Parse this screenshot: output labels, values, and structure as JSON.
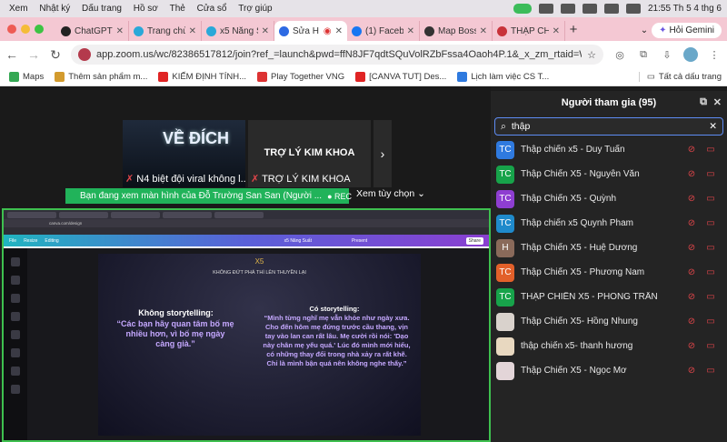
{
  "macbar": {
    "menu": [
      "Xem",
      "Nhật ký",
      "Dấu trang",
      "Hồ sơ",
      "Thẻ",
      "Cửa sổ",
      "Trợ giúp"
    ],
    "clock": "21:55 Th 5 4 thg 6"
  },
  "tabs": [
    {
      "label": "ChatGPT",
      "color": "#222"
    },
    {
      "label": "Trang chủ",
      "color": "#2aa8d8"
    },
    {
      "label": "x5 Năng S",
      "color": "#2aa8d8"
    },
    {
      "label": "Sửa H",
      "color": "#2d6ae3",
      "active": true
    },
    {
      "label": "(1) Facebo",
      "color": "#1877f2"
    },
    {
      "label": "Map Bosse",
      "color": "#333"
    },
    {
      "label": "THẬP CH",
      "color": "#c8333a"
    }
  ],
  "gemini_label": "Hỏi Gemini",
  "url": "app.zoom.us/wc/82386517812/join?ref_=launch&pwd=ffN8JF7qdtSQuVolRZbFssa4Oaoh4P.1&_x_zm_rtaid=WozPjdO5Ro...",
  "bookmarks": [
    {
      "label": "Maps",
      "color": "#34a853"
    },
    {
      "label": "Thêm sản phẩm m...",
      "color": "#d39b2e"
    },
    {
      "label": "KIẾM ĐỊNH TÍNH...",
      "color": "#e02424"
    },
    {
      "label": "Play Together VNG",
      "color": "#d33"
    },
    {
      "label": "[CANVA TUT] Des...",
      "color": "#e02424"
    },
    {
      "label": "Lịch làm việc CS T...",
      "color": "#2f7adf"
    }
  ],
  "bookmarks_all": "Tất cả dấu trang",
  "video": {
    "tile1_big": "VỀ ĐÍCH",
    "tile1_caption": "N4 biệt đội viral không l...",
    "tile2_caption": "TRỢ LÝ KIM KHOA",
    "tile2_center": "TRỢ LÝ KIM KHOA",
    "next_arrow": "›"
  },
  "viewing": {
    "text": "Bạn đang xem màn hình của  Đỗ Trường San San (Người ...",
    "rec": "REC",
    "options": "Xem tùy chọn"
  },
  "shared_slide": {
    "logo": "X5",
    "header": "KHÔNG ĐỨT PHÁ THÌ LÊN THUYỀN LẠI",
    "left_title": "Không storytelling:",
    "left_quote": "“Các bạn hãy quan tâm bố mẹ nhiều hơn, vì bố mẹ ngày càng già.”",
    "right_title": "Có storytelling:",
    "right_quote": "“Mình từng nghĩ mẹ vẫn khỏe như ngày xưa. Cho đến hôm mẹ đứng trước cầu thang, vịn tay vào lan can rất lâu. Mẹ cười rồi nói: 'Dạo này chân mẹ yếu quá.' Lúc đó mình mới hiểu, có những thay đổi trong nhà xảy ra rất khẽ. Chỉ là mình bận quá nên không nghe thấy.”",
    "toolbar_file": "File",
    "toolbar_resize": "Resize",
    "toolbar_editing": "Editing",
    "toolbar_title": "x5 Năng Suất",
    "toolbar_present": "Present",
    "toolbar_share": "Share"
  },
  "participants": {
    "title": "Người tham gia (95)",
    "search_value": "thập",
    "rows": [
      {
        "initials": "TC",
        "name": "Thập chiến x5 - Duy Tuấn",
        "color": "#2f7adf"
      },
      {
        "initials": "TC",
        "name": "Thập Chiến X5 - Nguyễn Văn",
        "color": "#17a34a"
      },
      {
        "initials": "TC",
        "name": "Thập Chiến X5 - Quỳnh",
        "color": "#8e3ed1"
      },
      {
        "initials": "TC",
        "name": "Thập chiến x5 Quynh Pham",
        "color": "#1f8acb"
      },
      {
        "initials": "H",
        "name": "Thập Chiến X5 - Huệ Dương",
        "color": "#8a6a5a"
      },
      {
        "initials": "TC",
        "name": "Thập Chiến X5 - Phương Nam",
        "color": "#e2602a"
      },
      {
        "initials": "TC",
        "name": "THẬP CHIẾN X5 - PHONG TRẦN",
        "color": "#17a34a"
      },
      {
        "initials": "",
        "name": "Thập Chiến X5- Hồng Nhung",
        "color": "#d9d2cc"
      },
      {
        "initials": "",
        "name": "thập chiến x5- thanh hương",
        "color": "#e8d8c0"
      },
      {
        "initials": "",
        "name": "Thập Chiến X5 - Ngọc Mơ",
        "color": "#e3d5d8"
      }
    ]
  }
}
